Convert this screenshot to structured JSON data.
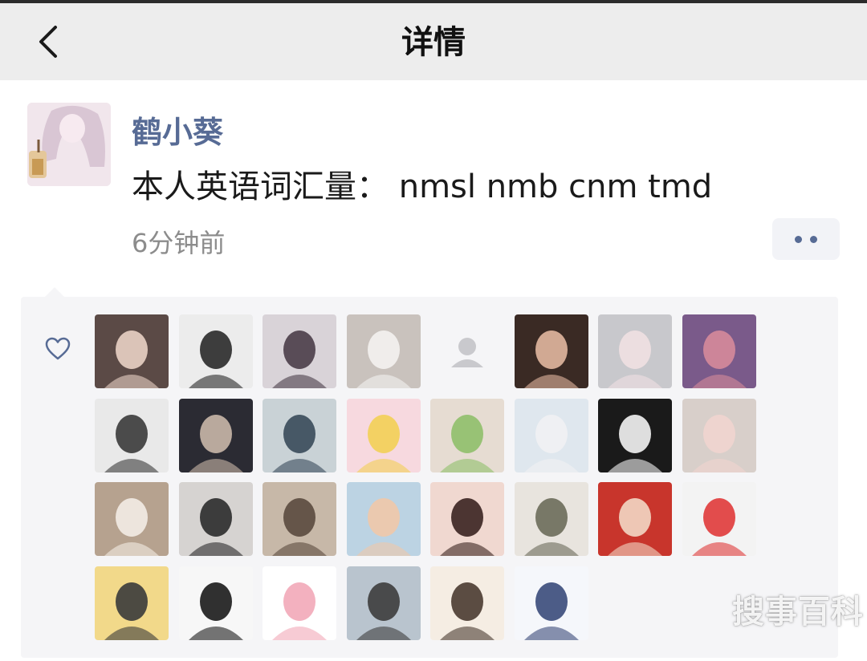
{
  "header": {
    "title": "详情",
    "back_icon": "chevron-left-icon"
  },
  "post": {
    "author": "鹤小葵",
    "text": "本人英语词汇量： nmsl nmb cnm tmd",
    "time": "6分钟前",
    "more_icon": "more-dots-icon"
  },
  "likes": {
    "icon": "heart-icon",
    "avatars": [
      "liker-avatar-1",
      "liker-avatar-2",
      "liker-avatar-3",
      "liker-avatar-4",
      "liker-avatar-5",
      "liker-avatar-6",
      "liker-avatar-7",
      "liker-avatar-8",
      "liker-avatar-9",
      "liker-avatar-10",
      "liker-avatar-11",
      "liker-avatar-12",
      "liker-avatar-13",
      "liker-avatar-14",
      "liker-avatar-15",
      "liker-avatar-16",
      "liker-avatar-17",
      "liker-avatar-18",
      "liker-avatar-19",
      "liker-avatar-20",
      "liker-avatar-21",
      "liker-avatar-22",
      "liker-avatar-23",
      "liker-avatar-24",
      "liker-avatar-25",
      "liker-avatar-26",
      "liker-avatar-27",
      "liker-avatar-28",
      "liker-avatar-29",
      "liker-avatar-30"
    ]
  },
  "watermark": "搜事百科",
  "colors": {
    "link": "#576b95",
    "header_bg": "#ededed",
    "likes_bg": "#f5f5f7",
    "time": "#8c8c8c"
  }
}
